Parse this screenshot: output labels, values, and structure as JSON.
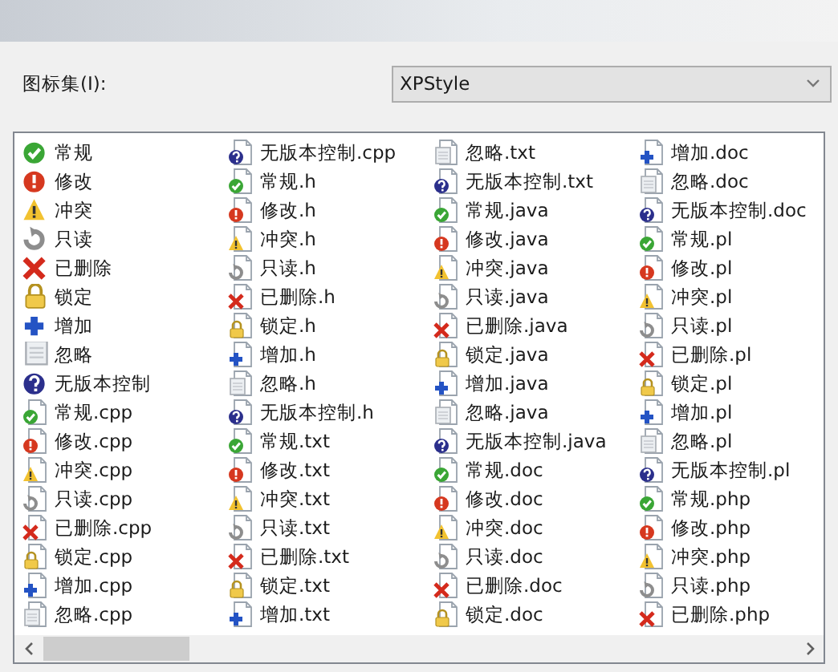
{
  "icon_set": {
    "label": "图标集(I):",
    "value": "XPStyle"
  },
  "items": [
    {
      "text": "常规",
      "kind": "normal",
      "file": false
    },
    {
      "text": "修改",
      "kind": "modified",
      "file": false
    },
    {
      "text": "冲突",
      "kind": "conflict",
      "file": false
    },
    {
      "text": "只读",
      "kind": "readonly",
      "file": false
    },
    {
      "text": "已删除",
      "kind": "deleted",
      "file": false
    },
    {
      "text": "锁定",
      "kind": "locked",
      "file": false
    },
    {
      "text": "增加",
      "kind": "added",
      "file": false
    },
    {
      "text": "忽略",
      "kind": "ignored",
      "file": false
    },
    {
      "text": "无版本控制",
      "kind": "unversioned",
      "file": false
    },
    {
      "text": "常规.cpp",
      "kind": "normal",
      "file": true
    },
    {
      "text": "修改.cpp",
      "kind": "modified",
      "file": true
    },
    {
      "text": "冲突.cpp",
      "kind": "conflict",
      "file": true
    },
    {
      "text": "只读.cpp",
      "kind": "readonly",
      "file": true
    },
    {
      "text": "已删除.cpp",
      "kind": "deleted",
      "file": true
    },
    {
      "text": "锁定.cpp",
      "kind": "locked",
      "file": true
    },
    {
      "text": "增加.cpp",
      "kind": "added",
      "file": true
    },
    {
      "text": "忽略.cpp",
      "kind": "ignored",
      "file": true
    },
    {
      "text": "无版本控制.cpp",
      "kind": "unversioned",
      "file": true
    },
    {
      "text": "常规.h",
      "kind": "normal",
      "file": true
    },
    {
      "text": "修改.h",
      "kind": "modified",
      "file": true
    },
    {
      "text": "冲突.h",
      "kind": "conflict",
      "file": true
    },
    {
      "text": "只读.h",
      "kind": "readonly",
      "file": true
    },
    {
      "text": "已删除.h",
      "kind": "deleted",
      "file": true
    },
    {
      "text": "锁定.h",
      "kind": "locked",
      "file": true
    },
    {
      "text": "增加.h",
      "kind": "added",
      "file": true
    },
    {
      "text": "忽略.h",
      "kind": "ignored",
      "file": true
    },
    {
      "text": "无版本控制.h",
      "kind": "unversioned",
      "file": true
    },
    {
      "text": "常规.txt",
      "kind": "normal",
      "file": true
    },
    {
      "text": "修改.txt",
      "kind": "modified",
      "file": true
    },
    {
      "text": "冲突.txt",
      "kind": "conflict",
      "file": true
    },
    {
      "text": "只读.txt",
      "kind": "readonly",
      "file": true
    },
    {
      "text": "已删除.txt",
      "kind": "deleted",
      "file": true
    },
    {
      "text": "锁定.txt",
      "kind": "locked",
      "file": true
    },
    {
      "text": "增加.txt",
      "kind": "added",
      "file": true
    },
    {
      "text": "忽略.txt",
      "kind": "ignored",
      "file": true
    },
    {
      "text": "无版本控制.txt",
      "kind": "unversioned",
      "file": true
    },
    {
      "text": "常规.java",
      "kind": "normal",
      "file": true
    },
    {
      "text": "修改.java",
      "kind": "modified",
      "file": true
    },
    {
      "text": "冲突.java",
      "kind": "conflict",
      "file": true
    },
    {
      "text": "只读.java",
      "kind": "readonly",
      "file": true
    },
    {
      "text": "已删除.java",
      "kind": "deleted",
      "file": true
    },
    {
      "text": "锁定.java",
      "kind": "locked",
      "file": true
    },
    {
      "text": "增加.java",
      "kind": "added",
      "file": true
    },
    {
      "text": "忽略.java",
      "kind": "ignored",
      "file": true
    },
    {
      "text": "无版本控制.java",
      "kind": "unversioned",
      "file": true
    },
    {
      "text": "常规.doc",
      "kind": "normal",
      "file": true
    },
    {
      "text": "修改.doc",
      "kind": "modified",
      "file": true
    },
    {
      "text": "冲突.doc",
      "kind": "conflict",
      "file": true
    },
    {
      "text": "只读.doc",
      "kind": "readonly",
      "file": true
    },
    {
      "text": "已删除.doc",
      "kind": "deleted",
      "file": true
    },
    {
      "text": "锁定.doc",
      "kind": "locked",
      "file": true
    },
    {
      "text": "增加.doc",
      "kind": "added",
      "file": true
    },
    {
      "text": "忽略.doc",
      "kind": "ignored",
      "file": true
    },
    {
      "text": "无版本控制.doc",
      "kind": "unversioned",
      "file": true
    },
    {
      "text": "常规.pl",
      "kind": "normal",
      "file": true
    },
    {
      "text": "修改.pl",
      "kind": "modified",
      "file": true
    },
    {
      "text": "冲突.pl",
      "kind": "conflict",
      "file": true
    },
    {
      "text": "只读.pl",
      "kind": "readonly",
      "file": true
    },
    {
      "text": "已删除.pl",
      "kind": "deleted",
      "file": true
    },
    {
      "text": "锁定.pl",
      "kind": "locked",
      "file": true
    },
    {
      "text": "增加.pl",
      "kind": "added",
      "file": true
    },
    {
      "text": "忽略.pl",
      "kind": "ignored",
      "file": true
    },
    {
      "text": "无版本控制.pl",
      "kind": "unversioned",
      "file": true
    },
    {
      "text": "常规.php",
      "kind": "normal",
      "file": true
    },
    {
      "text": "修改.php",
      "kind": "modified",
      "file": true
    },
    {
      "text": "冲突.php",
      "kind": "conflict",
      "file": true
    },
    {
      "text": "只读.php",
      "kind": "readonly",
      "file": true
    },
    {
      "text": "已删除.php",
      "kind": "deleted",
      "file": true
    }
  ]
}
